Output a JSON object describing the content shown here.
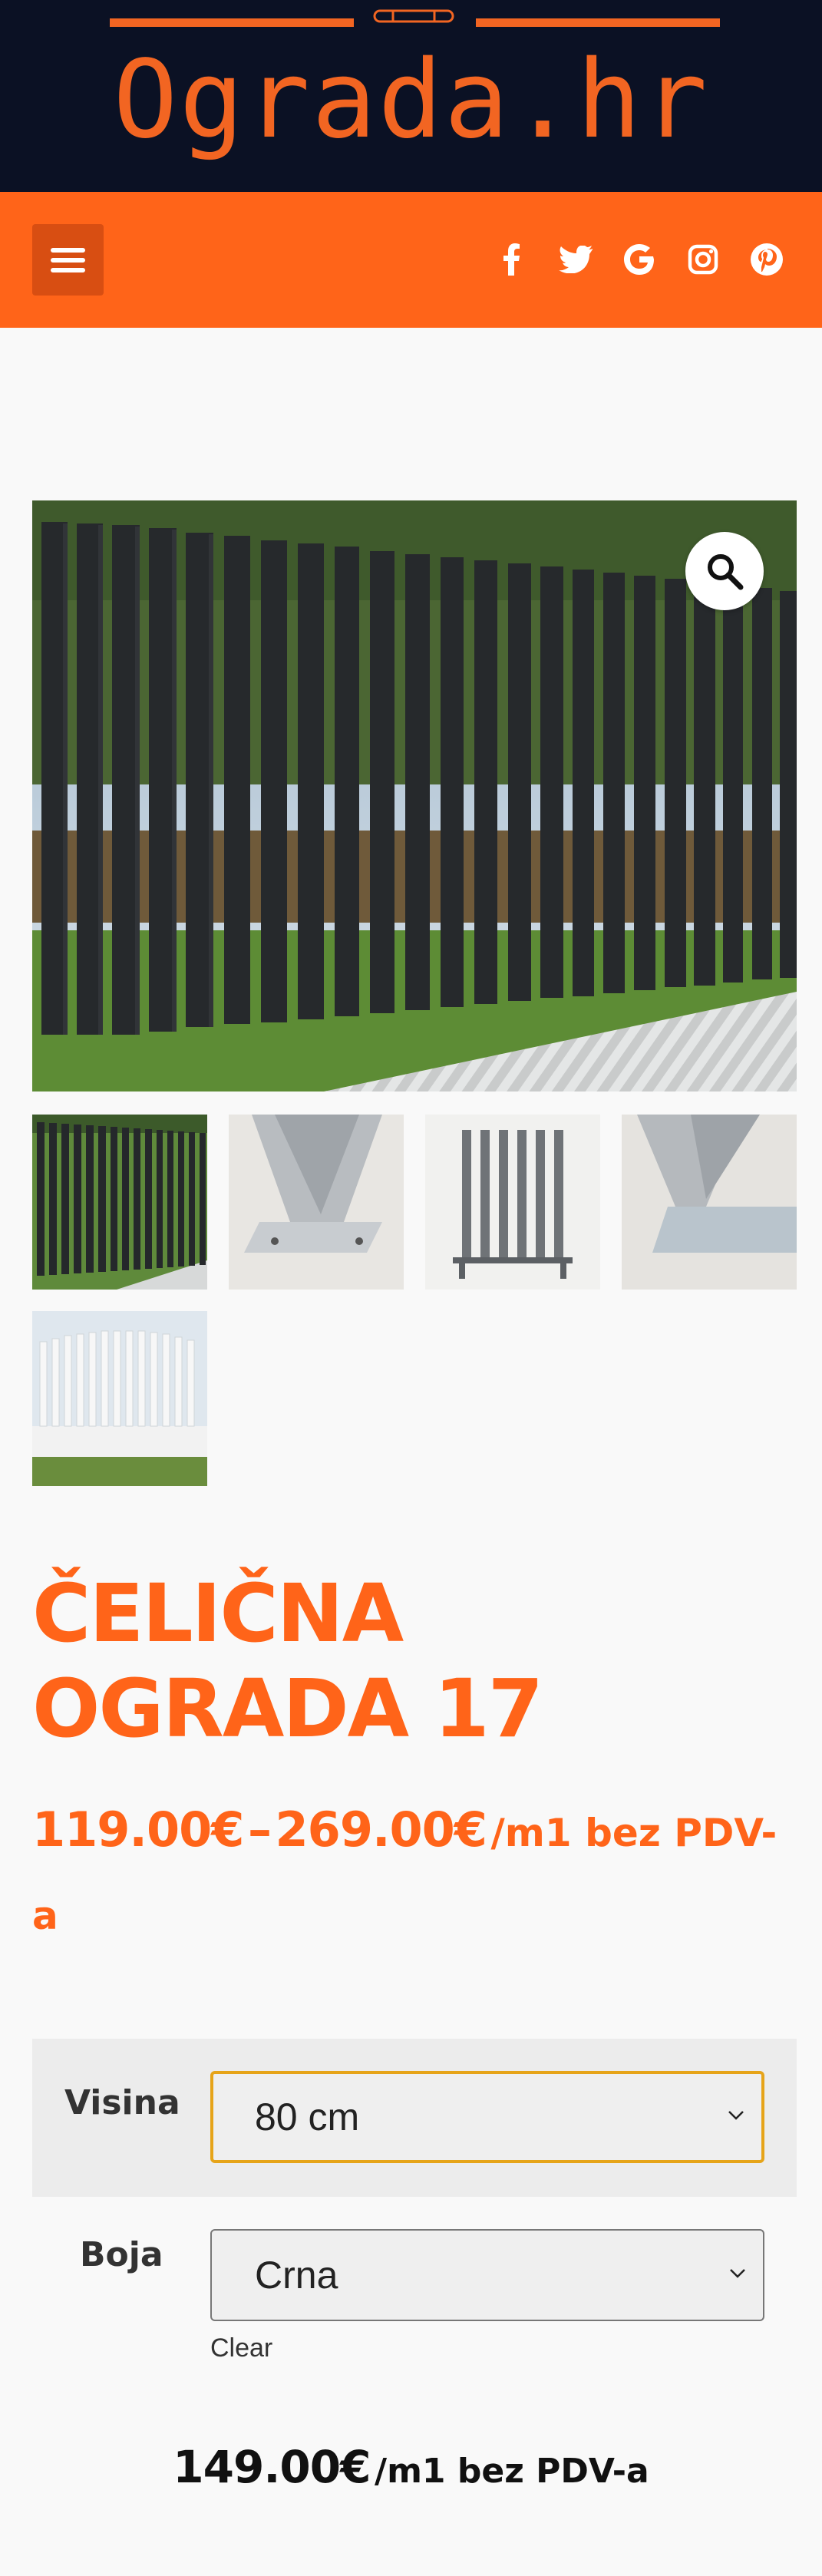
{
  "site": {
    "logo_text": "Ograda.hr",
    "colors": {
      "header_bg": "#0b1124",
      "accent": "#ff6419",
      "logo": "#f26522"
    }
  },
  "nav": {
    "menu_icon": "hamburger-menu-icon",
    "social": [
      "facebook-icon",
      "twitter-icon",
      "google-icon",
      "instagram-icon",
      "pinterest-icon"
    ]
  },
  "gallery": {
    "zoom_icon": "magnifier-icon",
    "thumbnail_count": 5
  },
  "product": {
    "title": "ČELIČNA\nOGRADA 17",
    "price_min": "119.00€",
    "price_separator": "–",
    "price_max": "269.00€",
    "price_suffix": "/m1 bez PDV-a"
  },
  "variations": {
    "height": {
      "label": "Visina",
      "value": "80 cm"
    },
    "color": {
      "label": "Boja",
      "value": "Crna"
    },
    "clear_label": "Clear"
  },
  "selected": {
    "price": "149.00€",
    "suffix": "/m1 bez PDV-a"
  }
}
